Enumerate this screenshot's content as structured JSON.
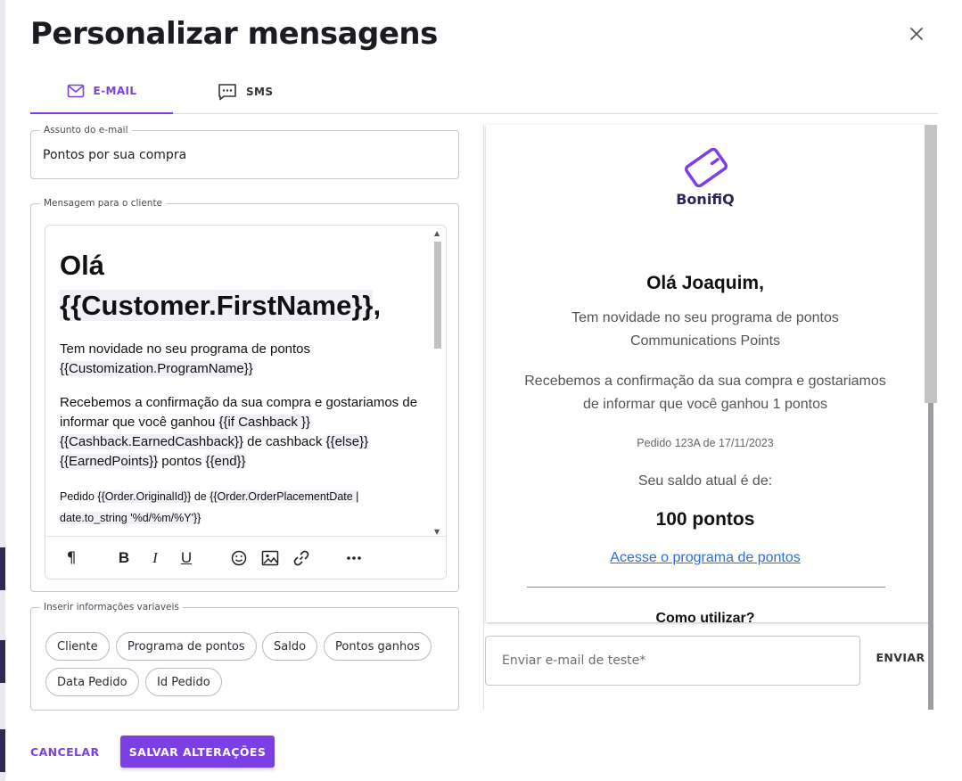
{
  "dialog": {
    "title": "Personalizar mensagens",
    "close_icon": "close-icon"
  },
  "tabs": [
    {
      "label": "E-MAIL",
      "icon": "mail-icon",
      "active": true
    },
    {
      "label": "SMS",
      "icon": "sms-icon",
      "active": false
    }
  ],
  "subject": {
    "legend": "Assunto do e-mail",
    "value": "Pontos por sua compra"
  },
  "message": {
    "legend": "Mensagem para o cliente",
    "heading_prefix": "Olá ",
    "heading_var": "{{Customer.FirstName}}",
    "heading_suffix": ",",
    "p1_text": "Tem novidade no seu programa de pontos ",
    "p1_var": "{{Customization.ProgramName}}",
    "p2_text": "Recebemos a confirmação da sua compra e gostariamos de informar que você ganhou ",
    "p2_var1": "{{if Cashback }}",
    "p2_var2": "{{Cashback.EarnedCashback}}",
    "p2_text2": " de cashback ",
    "p2_var3": "{{else}}",
    "p2_var4": "{{EarnedPoints}}",
    "p2_text3": " pontos ",
    "p2_var5": "{{end}}",
    "p3_text": "Pedido ",
    "p3_var1": "{{Order.OriginalId}}",
    "p3_text2": " de ",
    "p3_var2": "{{Order.OrderPlacementDate | date.to_string '%d/%m/%Y'}}"
  },
  "toolbar": {
    "paragraph": "¶",
    "bold": "B",
    "italic": "I",
    "underline": "U"
  },
  "variables": {
    "legend": "Inserir informações variaveis",
    "chips": [
      "Cliente",
      "Programa de pontos",
      "Saldo",
      "Pontos ganhos",
      "Data Pedido",
      "Id Pedido"
    ]
  },
  "preview": {
    "brand": "BonifiQ",
    "greeting": "Olá Joaquim,",
    "line1": "Tem novidade no seu programa de pontos Communications Points",
    "line2": "Recebemos a confirmação da sua compra e gostariamos de informar que você ganhou 1 pontos",
    "order": "Pedido 123A de 17/11/2023",
    "balance_label": "Seu saldo atual é de:",
    "balance": "100 pontos",
    "link": "Acesse o programa de pontos",
    "how_to": "Como utilizar?"
  },
  "test_email": {
    "placeholder": "Enviar e-mail de teste*",
    "send_label": "ENVIAR"
  },
  "actions": {
    "cancel": "CANCELAR",
    "save": "SALVAR ALTERAÇÕES"
  },
  "colors": {
    "accent": "#7b3fe4",
    "brand_dark": "#2b2656",
    "link": "#2f6dd0"
  }
}
